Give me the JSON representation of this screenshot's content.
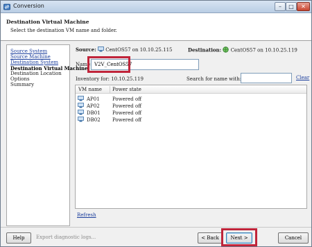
{
  "window": {
    "title": "Conversion",
    "controls": {
      "minimize": "–",
      "maximize": "□",
      "close": "✕"
    }
  },
  "header": {
    "title": "Destination Virtual Machine",
    "subtitle": "Select the destination VM name and folder."
  },
  "nav": {
    "items": [
      {
        "label": "Source System",
        "state": "link"
      },
      {
        "label": "Source Machine",
        "state": "link"
      },
      {
        "label": "Destination System",
        "state": "link"
      },
      {
        "label": "Destination Virtual Machine",
        "state": "current"
      },
      {
        "label": "Destination Location",
        "state": "plain"
      },
      {
        "label": "Options",
        "state": "plain"
      },
      {
        "label": "Summary",
        "state": "plain"
      }
    ]
  },
  "source": {
    "label": "Source:",
    "value": "CentOS57 on 10.10.25.115"
  },
  "destination": {
    "label": "Destination:",
    "value": "CentOS57 on 10.10.25.119"
  },
  "name_field": {
    "label": "Name:",
    "value": "V2V_CentOS57"
  },
  "inventory": {
    "label": "Inventory for:",
    "host": "10.10.25.119"
  },
  "search": {
    "label": "Search for name with:",
    "value": "",
    "clear_label": "Clear"
  },
  "vm_table": {
    "columns": [
      "VM name",
      "Power state"
    ],
    "rows": [
      {
        "name": "AP01",
        "state": "Powered off"
      },
      {
        "name": "AP02",
        "state": "Powered off"
      },
      {
        "name": "DB01",
        "state": "Powered off"
      },
      {
        "name": "DB02",
        "state": "Powered off"
      }
    ]
  },
  "refresh_label": "Refresh",
  "footer": {
    "help_label": "Help",
    "export_label": "Export diagnostic logs...",
    "back_label": "< Back",
    "next_label": "Next >",
    "cancel_label": "Cancel"
  },
  "colors": {
    "highlight": "#c0243a",
    "link": "#1a3d9c",
    "titlebar": "#c7d8eb"
  },
  "icons": {
    "app": "converter-app-icon",
    "source_vm": "vm-icon",
    "destination_host": "globe-vm-icon",
    "row": "vm-icon"
  }
}
